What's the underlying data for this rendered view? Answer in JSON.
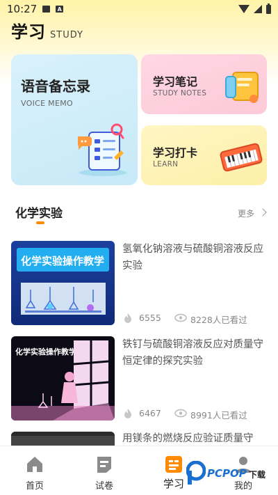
{
  "status_bar": {
    "time": "10:27"
  },
  "header": {
    "title": "学习",
    "subtitle": "STUDY"
  },
  "cards": {
    "voice": {
      "title": "语音备忘录",
      "subtitle": "VOICE MEMO"
    },
    "notes": {
      "title": "学习笔记",
      "subtitle": "STUDY NOTES"
    },
    "learn": {
      "title": "学习打卡",
      "subtitle": "LEARN"
    }
  },
  "section": {
    "title": "化学实验",
    "more_label": "更多"
  },
  "thumbnails": {
    "banner_text": "化学实验操作教学"
  },
  "list": [
    {
      "title": "氢氧化钠溶液与硫酸铜溶液反应实验",
      "likes": "6555",
      "views": "8228人已看过"
    },
    {
      "title": "铁钉与硫酸铜溶液反应对质量守恒定律的探究实验",
      "likes": "6467",
      "views": "8991人已看过"
    },
    {
      "title": "用镁条的燃烧反应验证质量守"
    }
  ],
  "nav": {
    "items": [
      {
        "label": "首页"
      },
      {
        "label": "试卷"
      },
      {
        "label": "学习"
      },
      {
        "label": "我的"
      }
    ],
    "active": "学习"
  },
  "watermark": {
    "text": "PCPOP",
    "suffix": "下载"
  },
  "colors": {
    "accent": "#ff8a00",
    "voice_card": "#c7e9f8",
    "notes_card": "#fcc9d8",
    "learn_card": "#fdefa8"
  }
}
